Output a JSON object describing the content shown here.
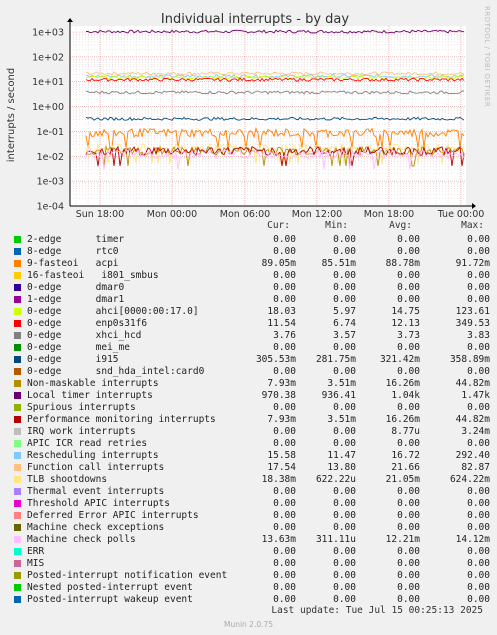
{
  "title": "Individual interrupts - by day",
  "credit": "RRDTOOL / TOBI OETIKER",
  "footer_version": "Munin 2.0.75",
  "last_update": "Last update: Tue Jul 15 00:25:13 2025",
  "legend_headers": {
    "cur": "Cur:",
    "min": "Min:",
    "avg": "Avg:",
    "max": "Max:"
  },
  "chart_data": {
    "type": "line",
    "title": "Individual interrupts - by day",
    "ylabel": "interrupts / second",
    "yscale": "log",
    "ylim": [
      0.0001,
      1000
    ],
    "y_ticks": [
      "1e-04",
      "1e-03",
      "1e-02",
      "1e-01",
      "1e+00",
      "1e+01",
      "1e+02",
      "1e+03"
    ],
    "x_ticks": [
      "Sun 18:00",
      "Mon 00:00",
      "Mon 06:00",
      "Mon 12:00",
      "Mon 18:00",
      "Tue 00:00"
    ],
    "grid": true,
    "series": [
      {
        "name": "2-edge      timer",
        "color": "#00cc00",
        "cur": "0.00",
        "min": "0.00",
        "avg": "0.00",
        "max": "0.00"
      },
      {
        "name": "8-edge      rtc0",
        "color": "#0066b3",
        "cur": "0.00",
        "min": "0.00",
        "avg": "0.00",
        "max": "0.00"
      },
      {
        "name": "9-fasteoi   acpi",
        "color": "#ff8000",
        "cur": "89.05m",
        "min": "85.51m",
        "avg": "88.78m",
        "max": "91.72m"
      },
      {
        "name": "16-fasteoi   i801_smbus",
        "color": "#ffcc00",
        "cur": "0.00",
        "min": "0.00",
        "avg": "0.00",
        "max": "0.00"
      },
      {
        "name": "0-edge      dmar0",
        "color": "#330099",
        "cur": "0.00",
        "min": "0.00",
        "avg": "0.00",
        "max": "0.00"
      },
      {
        "name": "1-edge      dmar1",
        "color": "#990099",
        "cur": "0.00",
        "min": "0.00",
        "avg": "0.00",
        "max": "0.00"
      },
      {
        "name": "0-edge      ahci[0000:00:17.0]",
        "color": "#ccff00",
        "cur": "18.03",
        "min": "5.97",
        "avg": "14.75",
        "max": "123.61"
      },
      {
        "name": "0-edge      enp0s31f6",
        "color": "#ff0000",
        "cur": "11.54",
        "min": "6.74",
        "avg": "12.13",
        "max": "349.53"
      },
      {
        "name": "0-edge      xhci_hcd",
        "color": "#808080",
        "cur": "3.76",
        "min": "3.57",
        "avg": "3.73",
        "max": "3.83"
      },
      {
        "name": "0-edge      mei_me",
        "color": "#008f00",
        "cur": "0.00",
        "min": "0.00",
        "avg": "0.00",
        "max": "0.00"
      },
      {
        "name": "0-edge      i915",
        "color": "#00487d",
        "cur": "305.53m",
        "min": "281.75m",
        "avg": "321.42m",
        "max": "358.89m"
      },
      {
        "name": "0-edge      snd_hda_intel:card0",
        "color": "#b35a00",
        "cur": "0.00",
        "min": "0.00",
        "avg": "0.00",
        "max": "0.00"
      },
      {
        "name": "Non-maskable interrupts",
        "color": "#b38f00",
        "cur": "7.93m",
        "min": "3.51m",
        "avg": "16.26m",
        "max": "44.82m"
      },
      {
        "name": "Local timer interrupts",
        "color": "#6b006b",
        "cur": "970.38",
        "min": "936.41",
        "avg": "1.04k",
        "max": "1.47k"
      },
      {
        "name": "Spurious interrupts",
        "color": "#8fb300",
        "cur": "0.00",
        "min": "0.00",
        "avg": "0.00",
        "max": "0.00"
      },
      {
        "name": "Performance monitoring interrupts",
        "color": "#b30000",
        "cur": "7.93m",
        "min": "3.51m",
        "avg": "16.26m",
        "max": "44.82m"
      },
      {
        "name": "IRQ work interrupts",
        "color": "#bebebe",
        "cur": "0.00",
        "min": "0.00",
        "avg": "8.77u",
        "max": "3.24m"
      },
      {
        "name": "APIC ICR read retries",
        "color": "#80ff80",
        "cur": "0.00",
        "min": "0.00",
        "avg": "0.00",
        "max": "0.00"
      },
      {
        "name": "Rescheduling interrupts",
        "color": "#80c9ff",
        "cur": "15.58",
        "min": "11.47",
        "avg": "16.72",
        "max": "292.40"
      },
      {
        "name": "Function call interrupts",
        "color": "#ffc080",
        "cur": "17.54",
        "min": "13.80",
        "avg": "21.66",
        "max": "82.87"
      },
      {
        "name": "TLB shootdowns",
        "color": "#ffe680",
        "cur": "18.38m",
        "min": "622.22u",
        "avg": "21.05m",
        "max": "624.22m"
      },
      {
        "name": "Thermal event interrupts",
        "color": "#aa80ff",
        "cur": "0.00",
        "min": "0.00",
        "avg": "0.00",
        "max": "0.00"
      },
      {
        "name": "Threshold APIC interrupts",
        "color": "#ee00cc",
        "cur": "0.00",
        "min": "0.00",
        "avg": "0.00",
        "max": "0.00"
      },
      {
        "name": "Deferred Error APIC interrupts",
        "color": "#ff8080",
        "cur": "0.00",
        "min": "0.00",
        "avg": "0.00",
        "max": "0.00"
      },
      {
        "name": "Machine check exceptions",
        "color": "#666600",
        "cur": "0.00",
        "min": "0.00",
        "avg": "0.00",
        "max": "0.00"
      },
      {
        "name": "Machine check polls",
        "color": "#ffbfff",
        "cur": "13.63m",
        "min": "311.11u",
        "avg": "12.21m",
        "max": "14.12m"
      },
      {
        "name": "ERR",
        "color": "#00ffcc",
        "cur": "0.00",
        "min": "0.00",
        "avg": "0.00",
        "max": "0.00"
      },
      {
        "name": "MIS",
        "color": "#cc6699",
        "cur": "0.00",
        "min": "0.00",
        "avg": "0.00",
        "max": "0.00"
      },
      {
        "name": "Posted-interrupt notification event",
        "color": "#999900",
        "cur": "0.00",
        "min": "0.00",
        "avg": "0.00",
        "max": "0.00"
      },
      {
        "name": "Nested posted-interrupt event",
        "color": "#00cc00",
        "cur": "0.00",
        "min": "0.00",
        "avg": "0.00",
        "max": "0.00"
      },
      {
        "name": "Posted-interrupt wakeup event",
        "color": "#0066b3",
        "cur": "0.00",
        "min": "0.00",
        "avg": "0.00",
        "max": "0.00"
      }
    ],
    "plotted_levels": [
      {
        "series": "Local timer interrupts",
        "value": 1040
      },
      {
        "series": "Function call interrupts",
        "value": 21.66
      },
      {
        "series": "Rescheduling interrupts",
        "value": 16.72
      },
      {
        "series": "0-edge      ahci[0000:00:17.0]",
        "value": 14.75
      },
      {
        "series": "0-edge      enp0s31f6",
        "value": 12.13
      },
      {
        "series": "0-edge      xhci_hcd",
        "value": 3.73
      },
      {
        "series": "0-edge      i915",
        "value": 0.3214
      },
      {
        "series": "9-fasteoi   acpi",
        "value": 0.08878
      },
      {
        "series": "TLB shootdowns",
        "value": 0.02105
      },
      {
        "series": "Non-maskable interrupts",
        "value": 0.01626
      },
      {
        "series": "Performance monitoring interrupts",
        "value": 0.01626
      },
      {
        "series": "Machine check polls",
        "value": 0.01221
      }
    ]
  }
}
